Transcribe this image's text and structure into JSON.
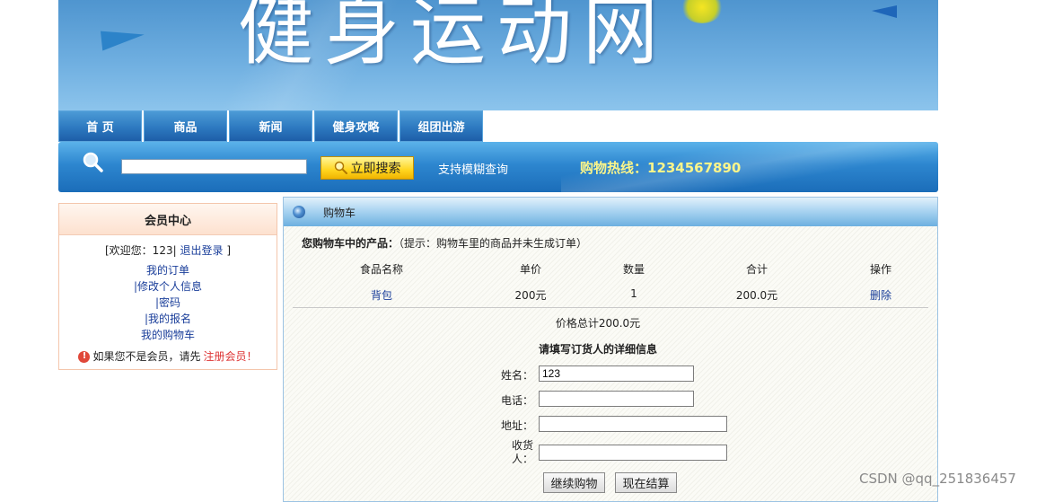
{
  "banner": {
    "title": "健身运动网"
  },
  "nav": {
    "items": [
      {
        "label": "首 页"
      },
      {
        "label": "商品"
      },
      {
        "label": "新闻"
      },
      {
        "label": "健身攻略"
      },
      {
        "label": "组团出游"
      }
    ]
  },
  "search": {
    "input_value": "",
    "button_label": "立即搜索",
    "tip": "支持模糊查询",
    "hotline": "购物热线：1234567890"
  },
  "member": {
    "title": "会员中心",
    "welcome_prefix": "[欢迎您：123|",
    "logout_label": "退出登录",
    "welcome_suffix": "]",
    "links": [
      "我的订单",
      "|修改个人信息",
      "|密码",
      "|我的报名",
      "我的购物车"
    ],
    "notice_prefix": "如果您不是会员，请先",
    "register_label": "注册会员！"
  },
  "cart": {
    "title": "购物车",
    "intro_bold": "您购物车中的产品：",
    "intro_hint": "（提示：购物车里的商品并未生成订单）",
    "columns": [
      "食品名称",
      "单价",
      "数量",
      "合计",
      "操作"
    ],
    "items": [
      {
        "name": "背包",
        "price": "200元",
        "qty": "1",
        "subtotal": "200.0元",
        "action": "删除"
      }
    ],
    "total": "价格总计200.0元",
    "form_title": "请填写订货人的详细信息",
    "form": {
      "name_label": "姓名：",
      "name_value": "123",
      "phone_label": "电话：",
      "phone_value": "",
      "address_label": "地址：",
      "address_value": "",
      "receiver_label_1": "收货",
      "receiver_label_2": "人：",
      "receiver_value": ""
    },
    "continue_label": "继续购物",
    "checkout_label": "现在结算"
  },
  "watermark": "CSDN @qq_251836457"
}
